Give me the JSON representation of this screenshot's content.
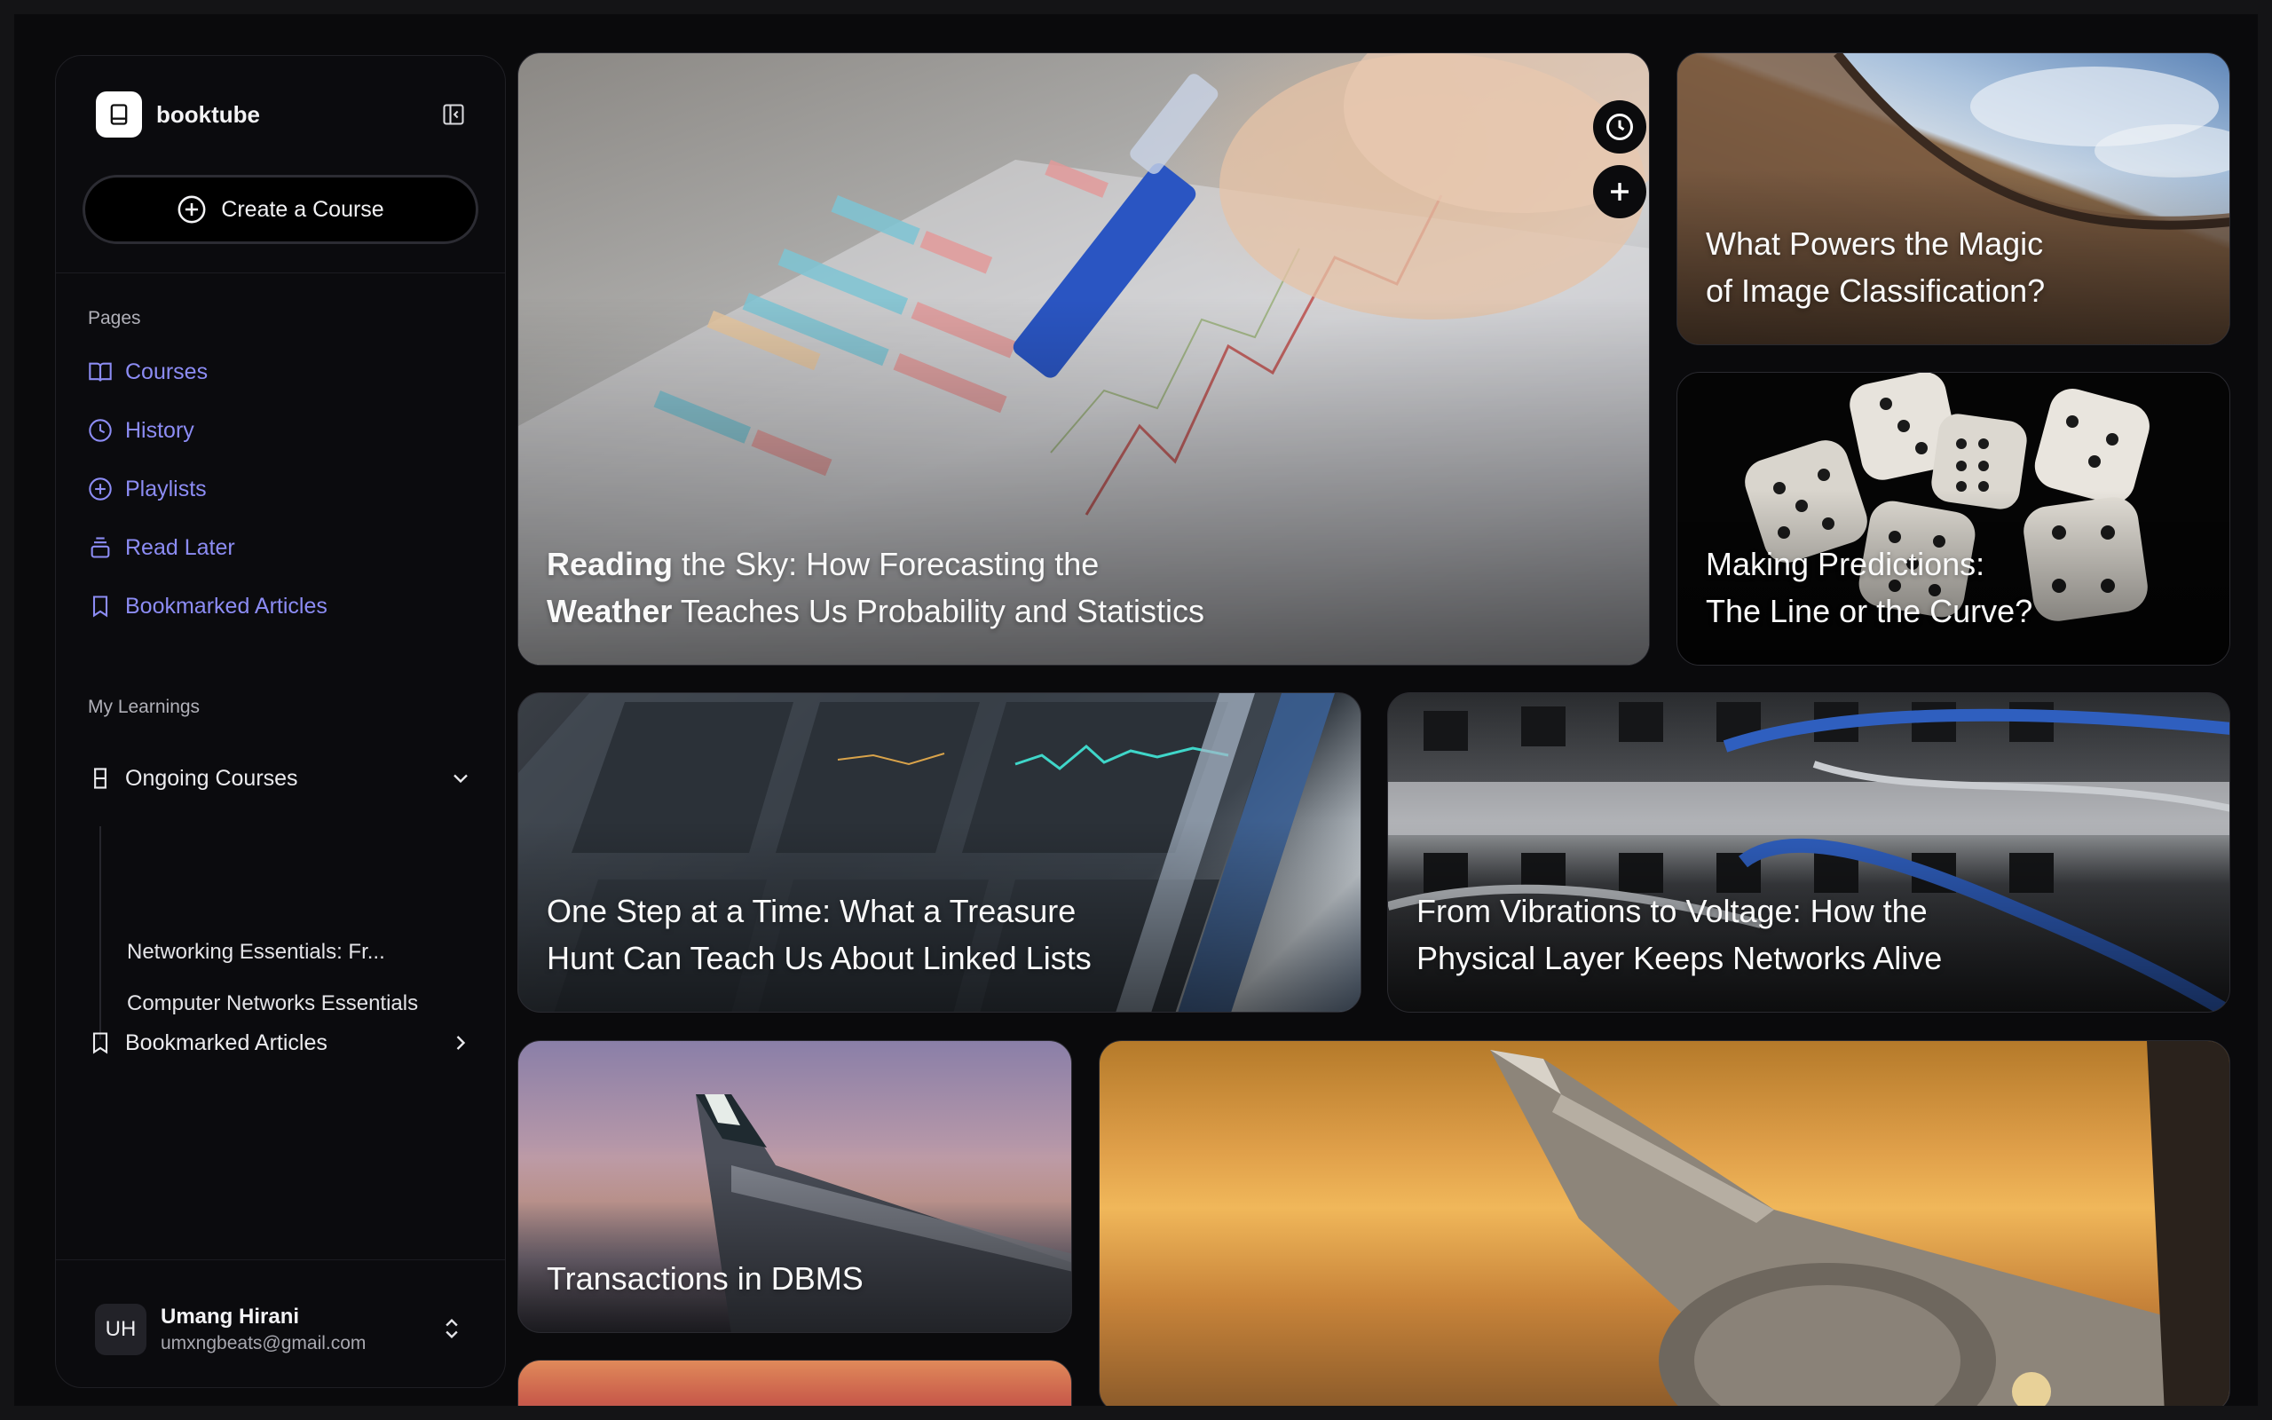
{
  "app": {
    "name": "booktube"
  },
  "sidebar": {
    "create_label": "Create a Course",
    "pages_label": "Pages",
    "pages": [
      {
        "label": "Courses",
        "icon": "book-open-icon"
      },
      {
        "label": "History",
        "icon": "clock-icon"
      },
      {
        "label": "Playlists",
        "icon": "plus-circle-icon"
      },
      {
        "label": "Read Later",
        "icon": "layers-icon"
      },
      {
        "label": "Bookmarked Articles",
        "icon": "bookmark-icon"
      }
    ],
    "learnings_label": "My Learnings",
    "ongoing_label": "Ongoing Courses",
    "ongoing_items": [
      "Networking Essentials: Fr...",
      "Computer Networks Essentials"
    ],
    "bookmarked_label": "Bookmarked Articles",
    "user": {
      "initials": "UH",
      "name": "Umang Hirani",
      "email": "umxngbeats@gmail.com"
    }
  },
  "cards": [
    {
      "title_bold_1": "Reading",
      "title_rest_1": " the Sky: How Forecasting the",
      "title_bold_2": "Weather",
      "title_rest_2": " Teaches Us Probability and Statistics"
    },
    {
      "line1": "What Powers the Magic",
      "line2": "of Image Classification?"
    },
    {
      "line1": "Making Predictions:",
      "line2": "The Line or the Curve?"
    },
    {
      "line1": "One Step at a Time: What a Treasure",
      "line2": "Hunt Can Teach Us About Linked Lists"
    },
    {
      "line1": "From Vibrations to Voltage: How the",
      "line2": "Physical Layer Keeps Networks Alive"
    },
    {
      "line1": "Transactions in DBMS"
    }
  ],
  "colors": {
    "accent": "#8c8cf4",
    "background": "#0a0a0c"
  }
}
